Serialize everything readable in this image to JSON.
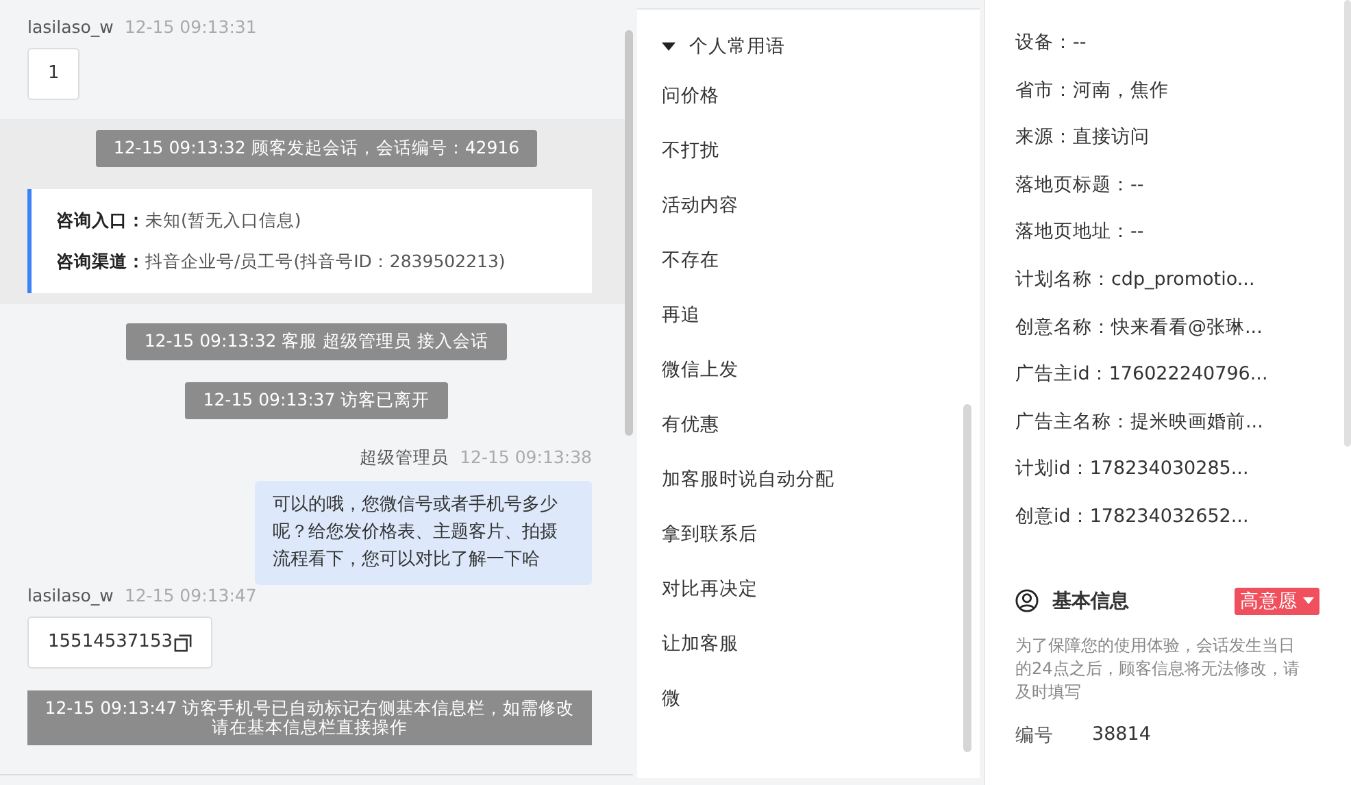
{
  "chat": {
    "messages": [
      {
        "kind": "visitor",
        "sender": "lasilaso_w",
        "time": "12-15 09:13:31",
        "text": "1",
        "copyable": false
      },
      {
        "kind": "session_notice",
        "text": "12-15 09:13:32 顾客发起会话，会话编号：42916"
      },
      {
        "kind": "info_card",
        "rows": [
          {
            "label": "咨询入口：",
            "value": "未知(暂无入口信息)"
          },
          {
            "label": "咨询渠道：",
            "value": "抖音企业号/员工号(抖音号ID：2839502213)"
          }
        ]
      },
      {
        "kind": "system",
        "text": "12-15 09:13:32 客服 超级管理员 接入会话"
      },
      {
        "kind": "system",
        "text": "12-15 09:13:37 访客已离开"
      },
      {
        "kind": "agent",
        "sender": "超级管理员",
        "time": "12-15 09:13:38",
        "text": "可以的哦，您微信号或者手机号多少呢？给您发价格表、主题客片、拍摄流程看下，您可以对比了解一下哈"
      },
      {
        "kind": "visitor",
        "sender": "lasilaso_w",
        "time": "12-15 09:13:47",
        "text": "15514537153",
        "copyable": true
      },
      {
        "kind": "notice",
        "text": "12-15 09:13:47 访客手机号已自动标记右侧基本信息栏，如需修改请在基本信息栏直接操作"
      }
    ]
  },
  "phrases": {
    "group": {
      "label": "个人常用语",
      "expanded": true
    },
    "items": [
      "问价格",
      "不打扰",
      "活动内容",
      "不存在",
      "再追",
      "微信上发",
      "有优惠",
      "加客服时说自动分配",
      "拿到联系后",
      "对比再决定",
      "让加客服",
      "微"
    ]
  },
  "visitor_info": {
    "lines": [
      "设备：--",
      "省市：河南，焦作",
      "来源：直接访问",
      "落地页标题：--",
      "落地页地址：--",
      "计划名称：cdp_promotio...",
      "创意名称：快来看看@张琳...",
      "广告主id：176022240796...",
      "广告主名称：提米映画婚前...",
      "计划id：178234030285...",
      "创意id：178234032652..."
    ]
  },
  "basic_info": {
    "title": "基本信息",
    "intent_tag": "高意愿",
    "note": "为了保障您的使用体验，会话发生当日的24点之后，顾客信息将无法修改，请及时填写",
    "fields": [
      {
        "label": "编号",
        "value": "38814"
      }
    ]
  }
}
